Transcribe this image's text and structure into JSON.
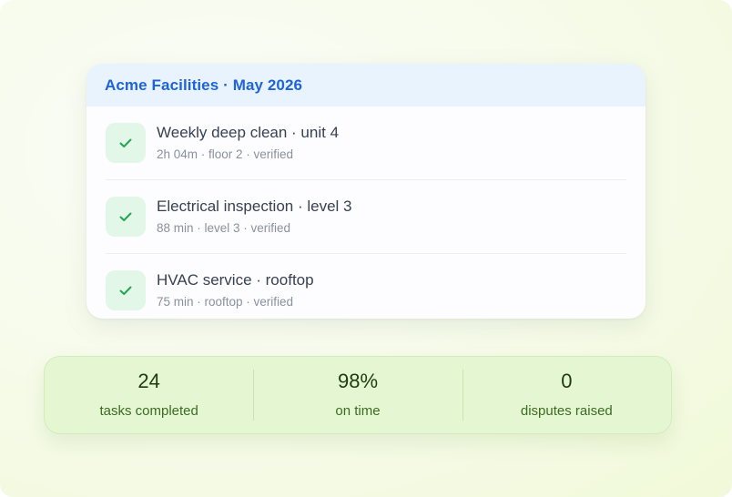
{
  "card": {
    "title": "Acme Facilities · May 2026",
    "items": [
      {
        "title": "Weekly deep clean · unit 4",
        "meta": "2h 04m · floor 2 · verified",
        "icon": "check-icon"
      },
      {
        "title": "Electrical inspection · level 3",
        "meta": "88 min · level 3 · verified",
        "icon": "check-icon"
      },
      {
        "title": "HVAC service · rooftop",
        "meta": "75 min · rooftop · verified",
        "icon": "check-icon"
      }
    ]
  },
  "stats": [
    {
      "value": "24",
      "label": "tasks completed"
    },
    {
      "value": "98%",
      "label": "on time"
    },
    {
      "value": "0",
      "label": "disputes raised"
    }
  ],
  "colors": {
    "header_bg": "#e8f3fd",
    "title": "#1e63d8",
    "check": "#22a652",
    "check_bg": "#e2f7e8",
    "stats_bg": "#e4f7d2"
  }
}
